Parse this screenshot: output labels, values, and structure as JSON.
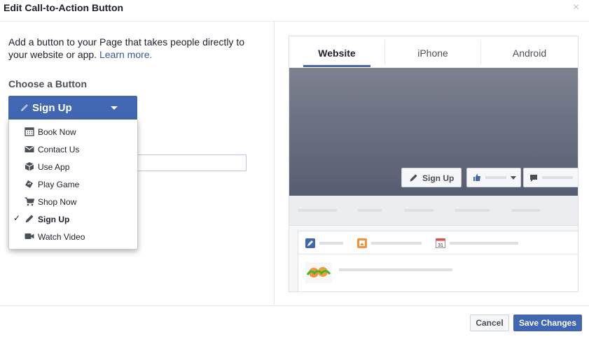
{
  "dialog": {
    "title": "Edit Call-to-Action Button",
    "close_glyph": "×"
  },
  "left": {
    "intro_text": "Add a button to your Page that takes people directly to your website or app.",
    "learn_more": "Learn more.",
    "choose_label": "Choose a Button",
    "selected_button": {
      "label": "Sign Up",
      "icon": "pencil-icon"
    },
    "menu_items": [
      {
        "label": "Book Now",
        "icon": "calendar-icon",
        "selected": false
      },
      {
        "label": "Contact Us",
        "icon": "envelope-icon",
        "selected": false
      },
      {
        "label": "Use App",
        "icon": "cube-icon",
        "selected": false
      },
      {
        "label": "Play Game",
        "icon": "gamepad-icon",
        "selected": false
      },
      {
        "label": "Shop Now",
        "icon": "cart-icon",
        "selected": false
      },
      {
        "label": "Sign Up",
        "icon": "pencil-icon",
        "selected": true
      },
      {
        "label": "Watch Video",
        "icon": "video-icon",
        "selected": false
      }
    ],
    "check_glyph": "✓"
  },
  "preview": {
    "tabs": [
      {
        "label": "Website",
        "active": true
      },
      {
        "label": "iPhone",
        "active": false
      },
      {
        "label": "Android",
        "active": false
      }
    ],
    "cta_label": "Sign Up",
    "calendar_day": "31"
  },
  "footer": {
    "cancel_label": "Cancel",
    "save_label": "Save Changes"
  },
  "colors": {
    "accent": "#4267b2",
    "link": "#365899"
  }
}
